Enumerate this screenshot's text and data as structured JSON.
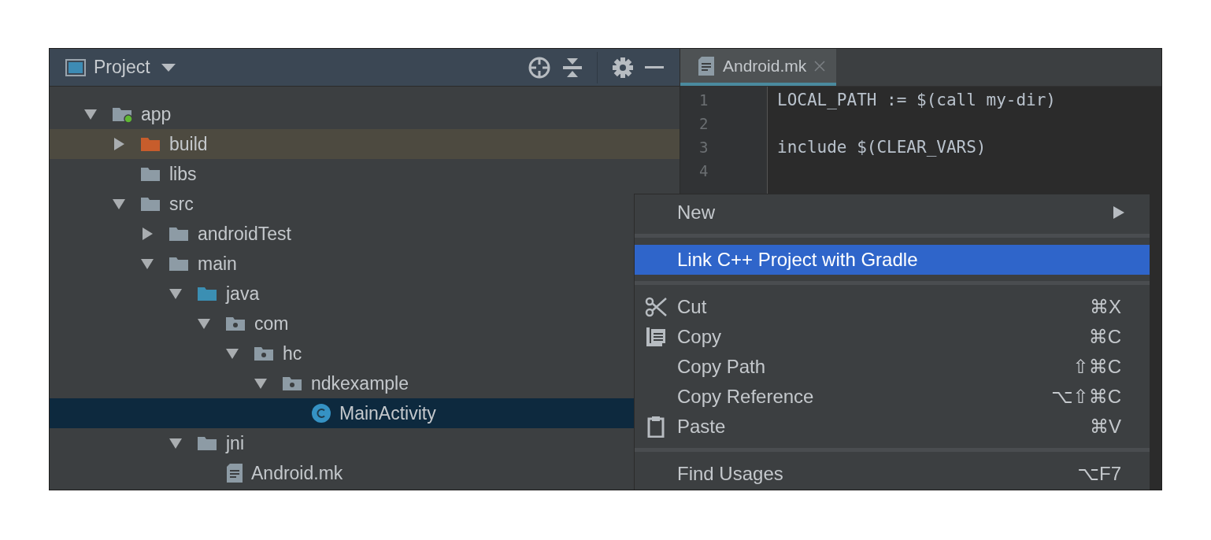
{
  "project_panel": {
    "title": "Project",
    "tree": [
      {
        "label": "app",
        "kind": "module",
        "expanded": true,
        "selected": false,
        "highlighted": false,
        "children": [
          {
            "label": "build",
            "kind": "excluded",
            "expanded": false,
            "selected": false,
            "highlighted": true
          },
          {
            "label": "libs",
            "kind": "folder",
            "selected": false,
            "highlighted": false
          },
          {
            "label": "src",
            "kind": "folder",
            "expanded": true,
            "selected": false,
            "highlighted": false,
            "children": [
              {
                "label": "androidTest",
                "kind": "folder",
                "expanded": false,
                "selected": false,
                "highlighted": false
              },
              {
                "label": "main",
                "kind": "folder",
                "expanded": true,
                "selected": false,
                "highlighted": false,
                "children": [
                  {
                    "label": "java",
                    "kind": "source",
                    "expanded": true,
                    "selected": false,
                    "highlighted": false,
                    "children": [
                      {
                        "label": "com",
                        "kind": "package",
                        "expanded": true,
                        "selected": false,
                        "highlighted": false,
                        "children": [
                          {
                            "label": "hc",
                            "kind": "package",
                            "expanded": true,
                            "selected": false,
                            "highlighted": false,
                            "children": [
                              {
                                "label": "ndkexample",
                                "kind": "package",
                                "expanded": true,
                                "selected": false,
                                "highlighted": false,
                                "children": [
                                  {
                                    "label": "MainActivity",
                                    "kind": "class",
                                    "selected": true,
                                    "highlighted": false
                                  }
                                ]
                              }
                            ]
                          }
                        ]
                      }
                    ]
                  },
                  {
                    "label": "jni",
                    "kind": "folder",
                    "expanded": true,
                    "selected": false,
                    "highlighted": false,
                    "children": [
                      {
                        "label": "Android.mk",
                        "kind": "file",
                        "selected": false,
                        "highlighted": false
                      }
                    ]
                  }
                ]
              }
            ]
          }
        ]
      }
    ]
  },
  "editor": {
    "tabs": [
      {
        "label": "Android.mk",
        "selected": true
      }
    ],
    "lines": [
      {
        "number": "1",
        "code": "LOCAL_PATH := $(call my-dir)"
      },
      {
        "number": "2"
      },
      {
        "number": "3",
        "code": "include $(CLEAR_VARS)"
      },
      {
        "number": "4"
      }
    ]
  },
  "context_menu": [
    {
      "kind": "submenu",
      "label": "New",
      "selected": false
    },
    {
      "kind": "separator"
    },
    {
      "kind": "plain",
      "label": "Link C++ Project with Gradle",
      "selected": true
    },
    {
      "kind": "separator"
    },
    {
      "kind": "cut",
      "label": "Cut",
      "shortcut": "⌘X",
      "selected": false
    },
    {
      "kind": "copy",
      "label": "Copy",
      "shortcut": "⌘C",
      "selected": false
    },
    {
      "kind": "plain",
      "label": "Copy Path",
      "shortcut": "⇧⌘C",
      "selected": false
    },
    {
      "kind": "plain",
      "label": "Copy Reference",
      "shortcut": "⌥⇧⌘C",
      "selected": false
    },
    {
      "kind": "paste",
      "label": "Paste",
      "shortcut": "⌘V",
      "selected": false
    },
    {
      "kind": "separator"
    },
    {
      "kind": "plain",
      "label": "Find Usages",
      "shortcut": "⌥F7",
      "selected": false
    }
  ]
}
